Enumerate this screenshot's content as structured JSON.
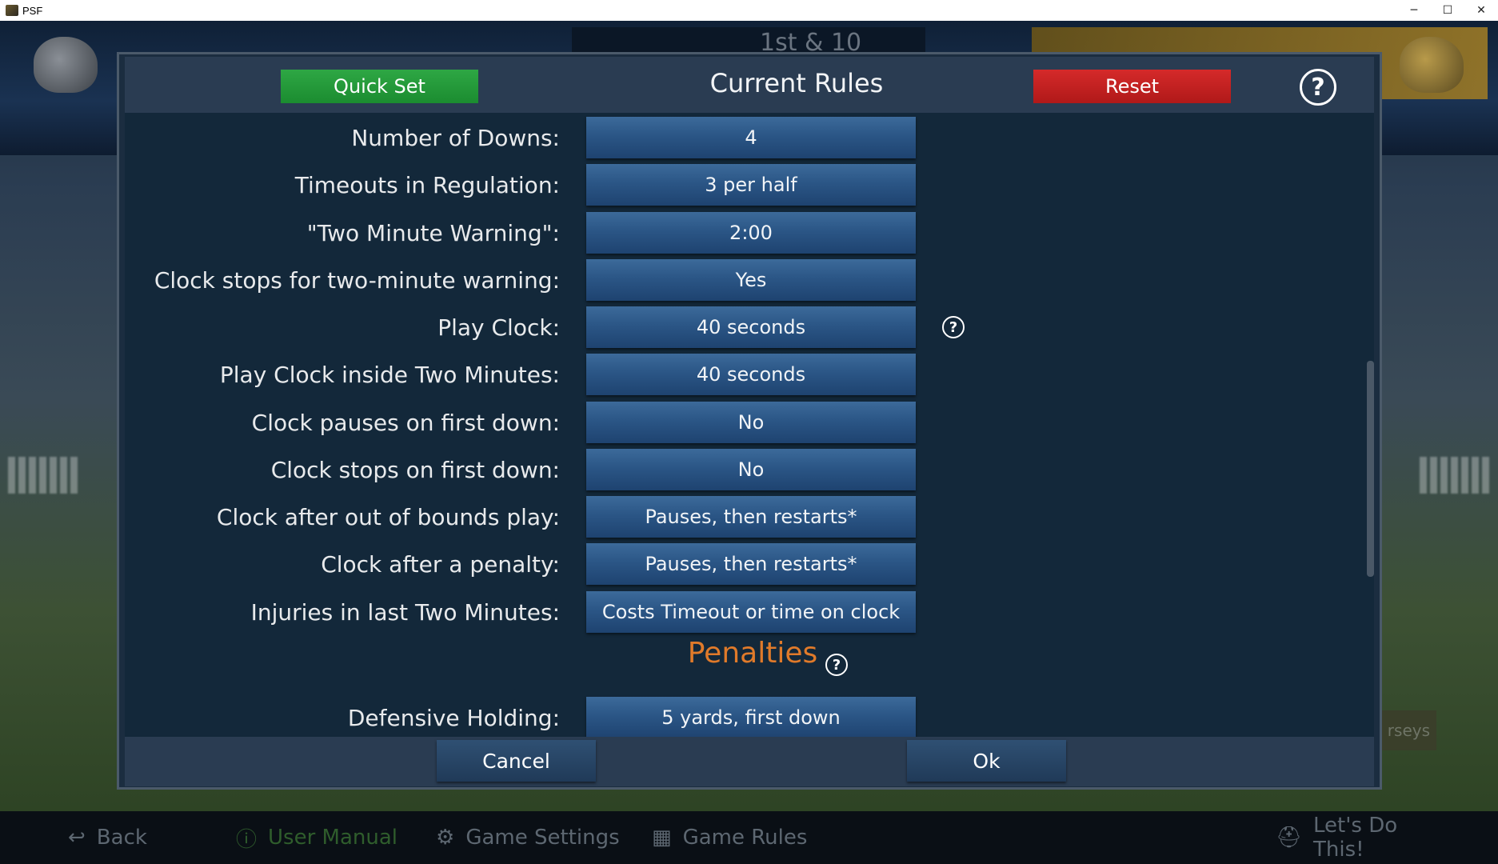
{
  "window": {
    "title": "PSF",
    "controls": {
      "minimize": "─",
      "maximize": "☐",
      "close": "✕"
    }
  },
  "background": {
    "scoreboard_text": "1st & 10",
    "bottom_nav": [
      {
        "label": "Back",
        "icon": "back-arrow-icon"
      },
      {
        "label": "User Manual",
        "icon": "info-icon"
      },
      {
        "label": "Game Settings",
        "icon": "gear-icon"
      },
      {
        "label": "Game Rules",
        "icon": "scoreboard-icon"
      },
      {
        "label": "Let's Do This!",
        "icon": "helmet-icon"
      }
    ],
    "side_button_label": "rseys"
  },
  "modal": {
    "title": "Current Rules",
    "quick_set_label": "Quick Set",
    "reset_label": "Reset",
    "help_label": "?",
    "rules": [
      {
        "label": "Number of Downs:",
        "value": "4"
      },
      {
        "label": "Timeouts in Regulation:",
        "value": "3 per half"
      },
      {
        "label": "\"Two Minute Warning\":",
        "value": "2:00"
      },
      {
        "label": "Clock stops for two-minute warning:",
        "value": "Yes"
      },
      {
        "label": "Play Clock:",
        "value": "40 seconds"
      },
      {
        "label": "Play Clock inside Two Minutes:",
        "value": "40 seconds"
      },
      {
        "label": "Clock pauses on first down:",
        "value": "No"
      },
      {
        "label": "Clock stops on first down:",
        "value": "No"
      },
      {
        "label": "Clock after out of bounds play:",
        "value": "Pauses, then restarts*"
      },
      {
        "label": "Clock after a penalty:",
        "value": "Pauses, then restarts*"
      },
      {
        "label": "Injuries in last Two Minutes:",
        "value": "Costs Timeout or time on clock"
      }
    ],
    "penalties_title": "Penalties",
    "penalty_rules": [
      {
        "label": "Defensive Holding:",
        "value": "5 yards, first down"
      }
    ],
    "cancel_label": "Cancel",
    "ok_label": "Ok"
  },
  "colors": {
    "quick_set": "#2ea744",
    "reset": "#d52a2a",
    "section_title": "#e07a2a",
    "value_button": "#2b5686"
  }
}
